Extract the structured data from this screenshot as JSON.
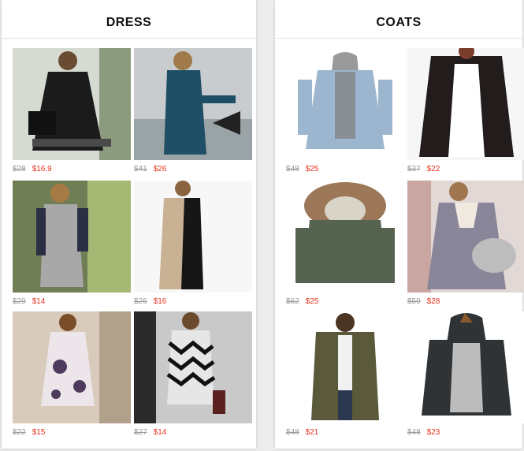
{
  "panels": [
    {
      "title": "DRESS",
      "items": [
        {
          "icon": "black-fringe-dress-photo",
          "old": "$28",
          "new": "$16.9"
        },
        {
          "icon": "blue-sequin-dress-photo",
          "old": "$41",
          "new": "$26"
        },
        {
          "icon": "grey-knit-dress-photo",
          "old": "$29",
          "new": "$14"
        },
        {
          "icon": "gold-sequin-dress-photo",
          "old": "$26",
          "new": "$16"
        },
        {
          "icon": "floral-print-dress-photo",
          "old": "$22",
          "new": "$15"
        },
        {
          "icon": "chevron-print-dress-photo",
          "old": "$27",
          "new": "$14"
        }
      ]
    },
    {
      "title": "COATS",
      "items": [
        {
          "icon": "denim-hooded-jacket-photo",
          "old": "$48",
          "new": "$25"
        },
        {
          "icon": "black-bomber-jacket-photo",
          "old": "$37",
          "new": "$22"
        },
        {
          "icon": "fur-hood-parka-photo",
          "old": "$62",
          "new": "$25"
        },
        {
          "icon": "grey-fleece-coat-photo",
          "old": "$59",
          "new": "$28"
        },
        {
          "icon": "olive-parka-photo",
          "old": "$48",
          "new": "$21"
        },
        {
          "icon": "grey-hooded-cardigan-photo",
          "old": "$48",
          "new": "$23"
        }
      ]
    }
  ]
}
